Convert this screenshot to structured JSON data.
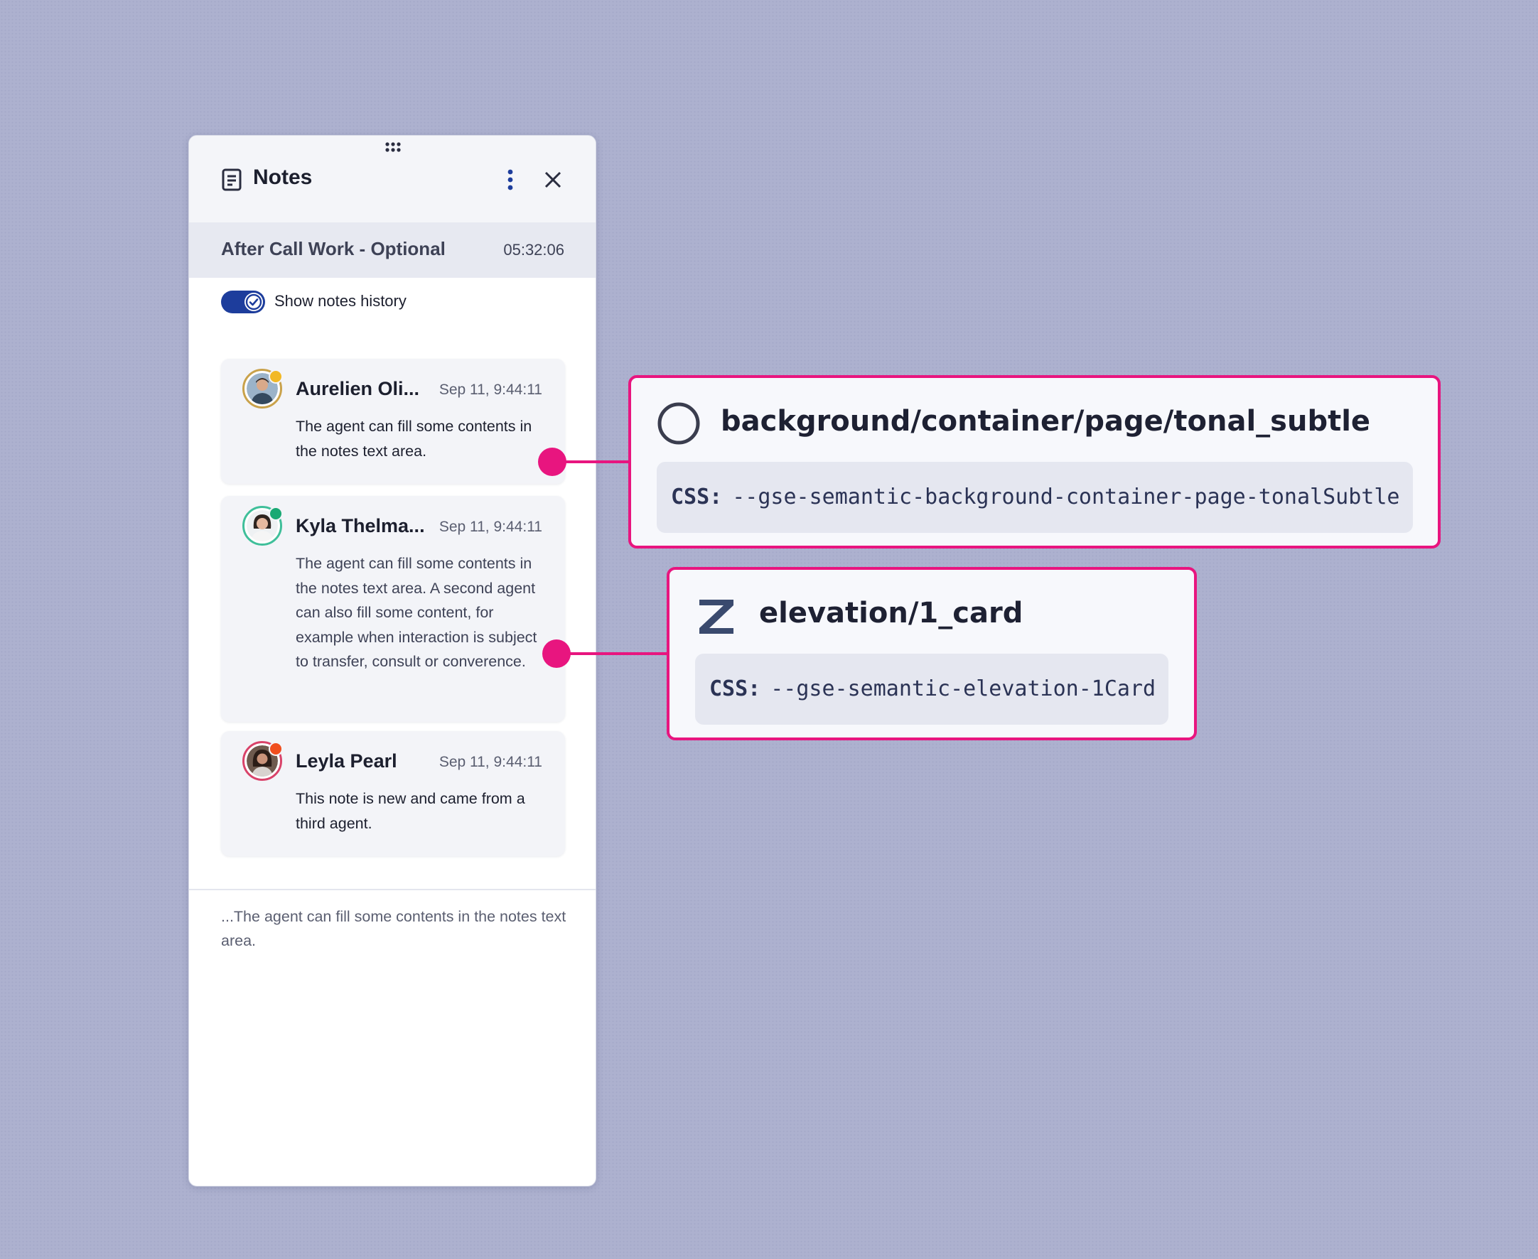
{
  "panel": {
    "title": "Notes",
    "acw_label": "After Call Work - Optional",
    "acw_timer": "05:32:06",
    "toggle_label": "Show notes history",
    "notes": [
      {
        "author": "Aurelien Oli...",
        "time": "Sep 11, 9:44:11",
        "body": "The agent can fill some contents in the notes text area.",
        "status_color": "#f2b824",
        "ring_color": "#c9a24b"
      },
      {
        "author": "Kyla Thelma...",
        "time": "Sep 11, 9:44:11",
        "body": "The agent can fill some contents in the notes text area. A second agent can also fill some content, for example when interaction is subject to transfer, consult or converence.",
        "status_color": "#19a974",
        "ring_color": "#3fbf9a"
      },
      {
        "author": "Leyla Pearl",
        "time": "Sep 11, 9:44:11",
        "body": "This note is new and came from a third agent.",
        "status_color": "#f04e1e",
        "ring_color": "#d9436a"
      }
    ],
    "draft_text": "...The agent can fill some contents in the notes text area."
  },
  "annotations": [
    {
      "token": "background/container/page/tonal_subtle",
      "css_label": "CSS:",
      "css_var": "--gse-semantic-background-container-page-tonalSubtle",
      "icon": "circle-outline-icon"
    },
    {
      "token": "elevation/1_card",
      "css_label": "CSS:",
      "css_var": "--gse-semantic-elevation-1Card",
      "icon": "z-elevation-icon"
    }
  ],
  "colors": {
    "accent": "#e8157f",
    "toggle": "#1d3d9c",
    "background": "#adb1cf"
  }
}
